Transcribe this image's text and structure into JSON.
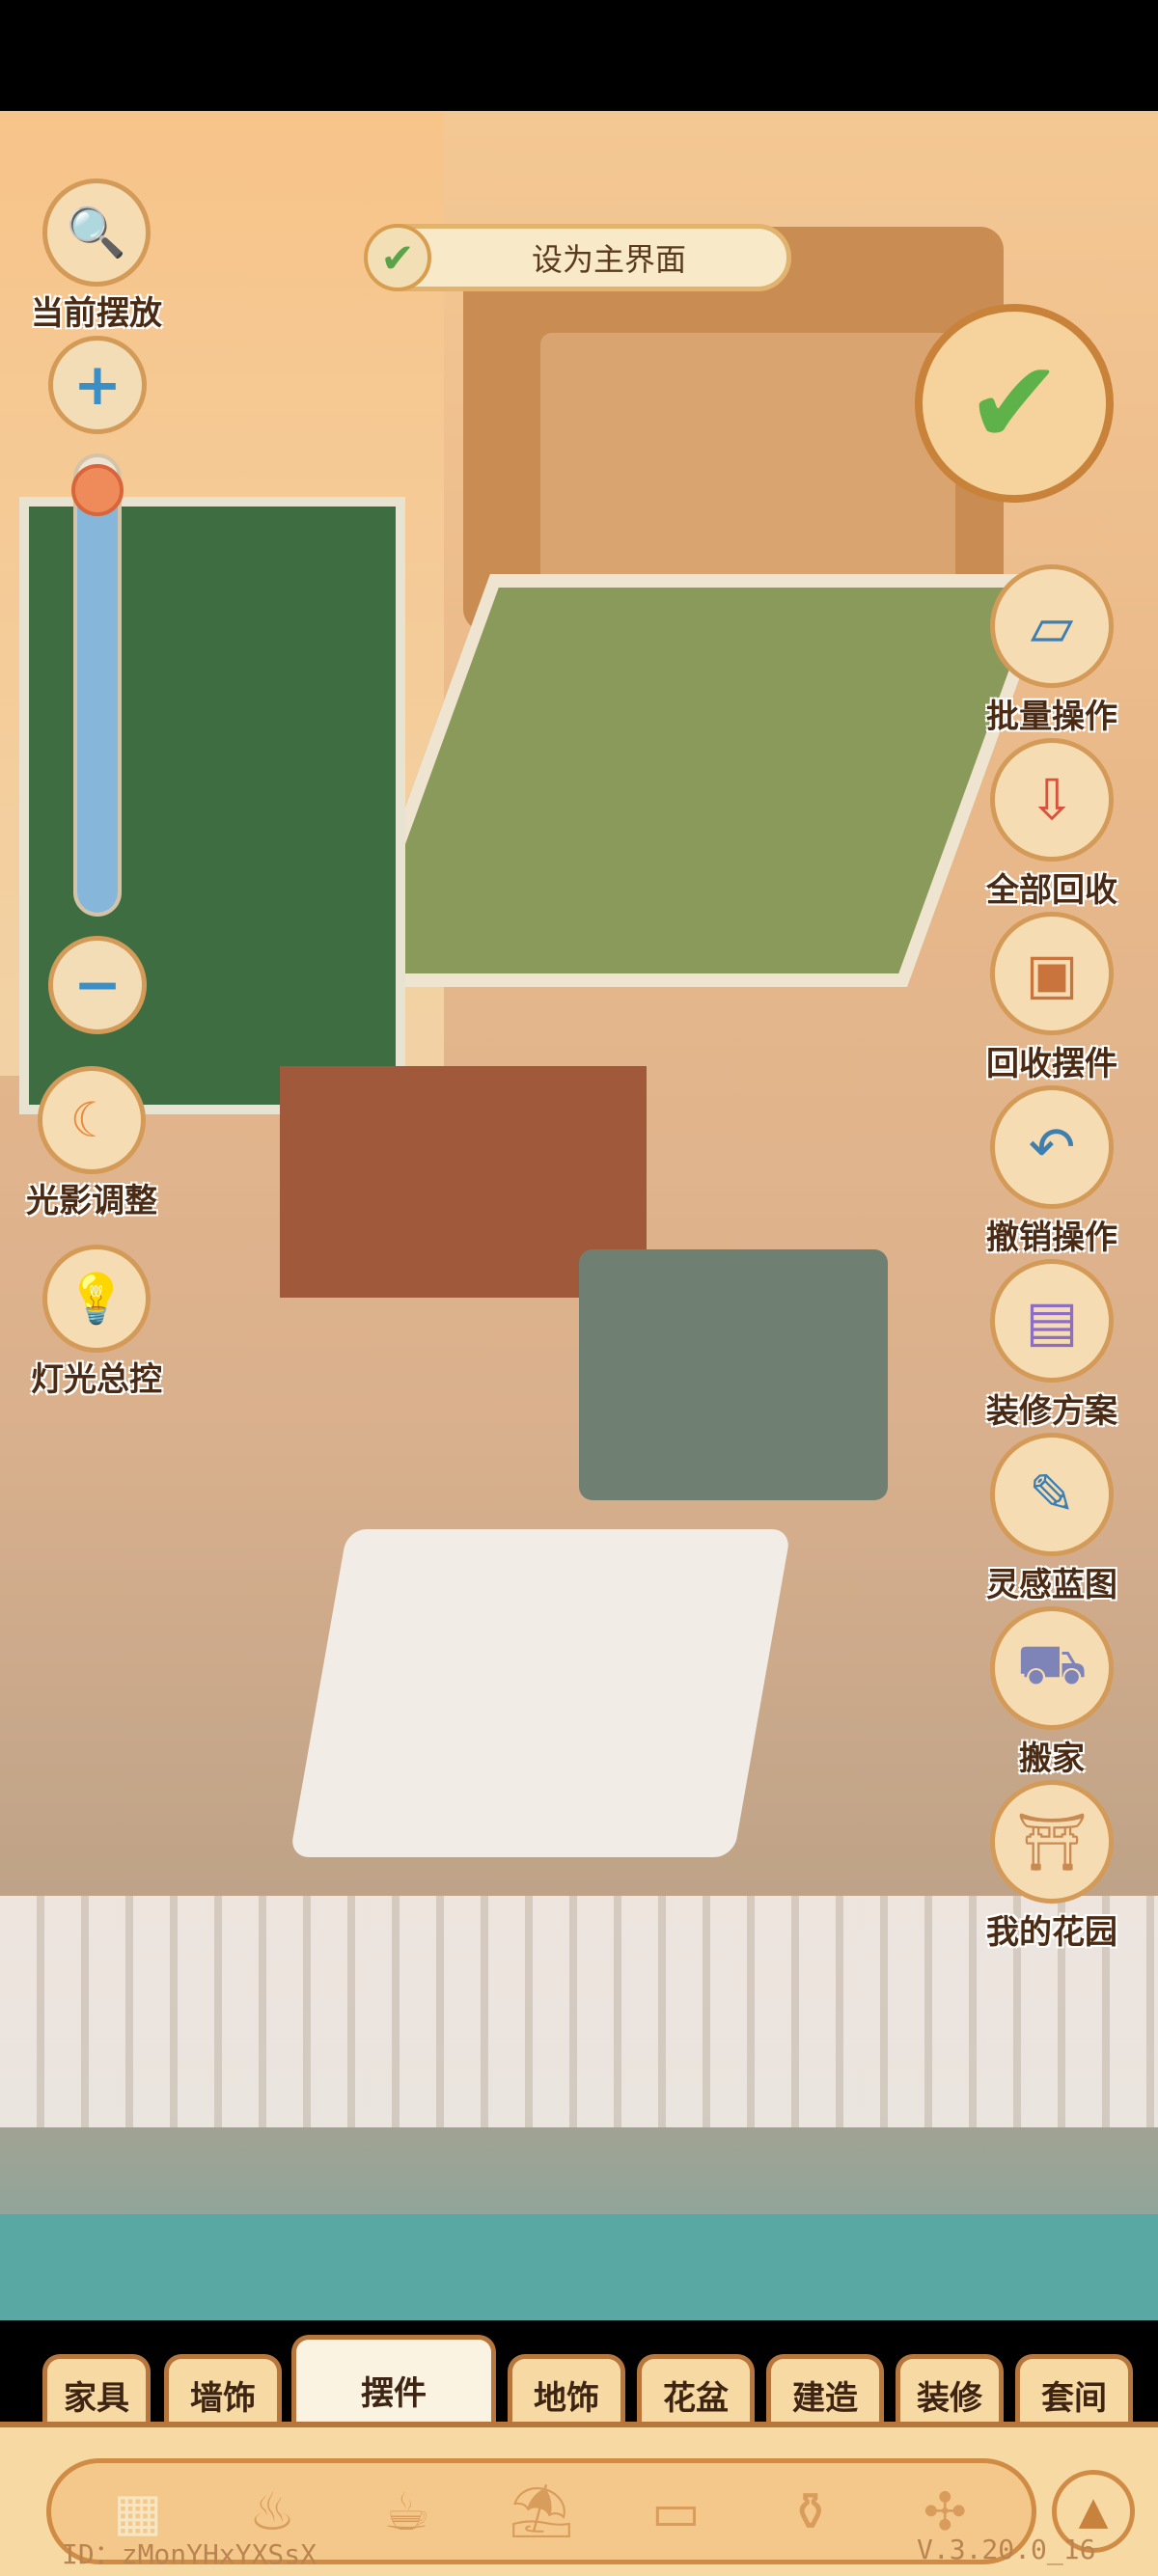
{
  "main_interface": {
    "label": "设为主界面"
  },
  "left_controls": {
    "current_placement": "当前摆放",
    "light_shadow": "光影调整",
    "light_control": "灯光总控",
    "zoom_level": 0.92
  },
  "right_menu": [
    {
      "label": "批量操作",
      "icon": "batch-icon"
    },
    {
      "label": "全部回收",
      "icon": "recycle-all-icon"
    },
    {
      "label": "回收摆件",
      "icon": "recycle-item-icon"
    },
    {
      "label": "撤销操作",
      "icon": "undo-icon"
    },
    {
      "label": "装修方案",
      "icon": "plan-icon"
    },
    {
      "label": "灵感蓝图",
      "icon": "blueprint-icon"
    },
    {
      "label": "搬家",
      "icon": "truck-icon"
    },
    {
      "label": "我的花园",
      "icon": "garden-icon"
    }
  ],
  "tabs": [
    "家具",
    "墙饰",
    "摆件",
    "地饰",
    "花盆",
    "建造",
    "装修",
    "套间"
  ],
  "active_tab": "摆件",
  "categories": [
    "grid-icon",
    "pot-icon",
    "cup-icon",
    "lamp-icon",
    "pillow-icon",
    "vase-icon",
    "fan-icon"
  ],
  "footer": {
    "id": "ID：zMonYHxYXSsX",
    "version": "V.3.20.0_16"
  },
  "colors": {
    "accent": "#d49a58",
    "confirm_green": "#5fb14a",
    "panel": "#f7d9a4"
  }
}
